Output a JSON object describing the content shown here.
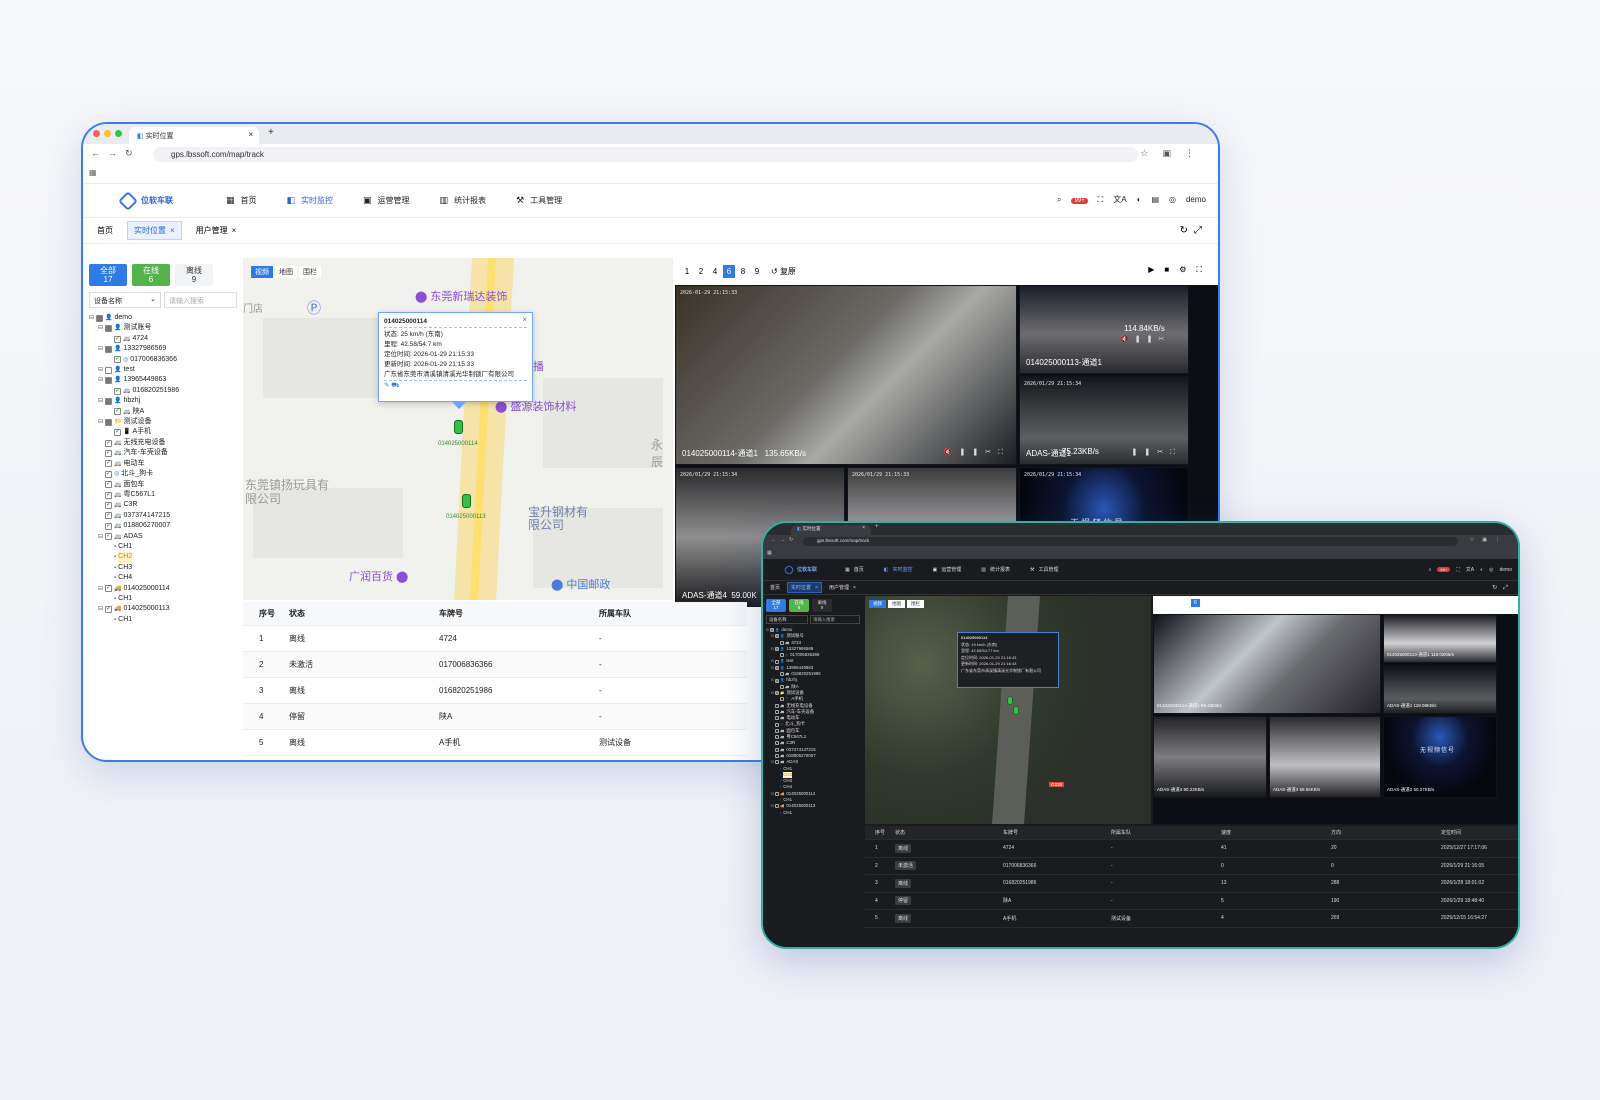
{
  "browser": {
    "tab_title": "实时位置",
    "url": "gps.lbssoft.com/map/track"
  },
  "app": {
    "logo": "位软车联",
    "user": "demo",
    "badge": "99+"
  },
  "menu": [
    {
      "label": "首页",
      "icon": "▦"
    },
    {
      "label": "实时监控",
      "icon": "◧"
    },
    {
      "label": "运营管理",
      "icon": "▣"
    },
    {
      "label": "统计报表",
      "icon": "▥"
    },
    {
      "label": "工具管理",
      "icon": "⚒"
    }
  ],
  "tags": [
    {
      "label": "首页"
    },
    {
      "label": "实时位置"
    },
    {
      "label": "用户管理"
    }
  ],
  "filter": {
    "all_label": "全部",
    "all_count": "17",
    "online_label": "在线",
    "online_count": "6",
    "offline_label": "离线",
    "offline_count": "9",
    "select": "设备名称",
    "search_placeholder": "请输入搜索"
  },
  "tree": [
    {
      "lvl": 0,
      "exp": "⊟",
      "cb": "part",
      "icon": "👤",
      "text": "demo"
    },
    {
      "lvl": 1,
      "exp": "⊟",
      "cb": "part",
      "icon": "👤",
      "text": "测试账号"
    },
    {
      "lvl": 2,
      "exp": "",
      "cb": "chk",
      "icon": "🚐",
      "text": "4724"
    },
    {
      "lvl": 1,
      "exp": "⊟",
      "cb": "part",
      "icon": "👤",
      "text": "13327986569"
    },
    {
      "lvl": 2,
      "exp": "",
      "cb": "chk",
      "icon": "◎",
      "text": "017006836366"
    },
    {
      "lvl": 1,
      "exp": "⊟",
      "cb": "",
      "icon": "👤",
      "text": "test"
    },
    {
      "lvl": 1,
      "exp": "⊟",
      "cb": "part",
      "icon": "👤",
      "text": "13965449863"
    },
    {
      "lvl": 2,
      "exp": "",
      "cb": "chk",
      "icon": "🚐",
      "text": "016820251986"
    },
    {
      "lvl": 1,
      "exp": "⊟",
      "cb": "part",
      "icon": "👤",
      "text": "hbzhj"
    },
    {
      "lvl": 2,
      "exp": "",
      "cb": "chk",
      "icon": "🚐",
      "text": "陕A"
    },
    {
      "lvl": 1,
      "exp": "⊟",
      "cb": "part",
      "icon": "📁",
      "text": "测试设备"
    },
    {
      "lvl": 2,
      "exp": "",
      "cb": "chk",
      "icon": "📱",
      "text": "A手机"
    },
    {
      "lvl": 1,
      "exp": "",
      "cb": "chk",
      "icon": "🚐",
      "text": "无线充电设备"
    },
    {
      "lvl": 1,
      "exp": "",
      "cb": "chk",
      "icon": "🚐",
      "text": "汽车-车壳设备"
    },
    {
      "lvl": 1,
      "exp": "",
      "cb": "chk",
      "icon": "🚐",
      "text": "电动车"
    },
    {
      "lvl": 1,
      "exp": "",
      "cb": "chk",
      "icon": "◎",
      "text": "北斗_狗卡"
    },
    {
      "lvl": 1,
      "exp": "",
      "cb": "chk",
      "icon": "🚐",
      "text": "面包车"
    },
    {
      "lvl": 1,
      "exp": "",
      "cb": "chk",
      "icon": "🚐",
      "text": "粤C567L1"
    },
    {
      "lvl": 1,
      "exp": "",
      "cb": "chk",
      "icon": "🚐",
      "text": "C3R"
    },
    {
      "lvl": 1,
      "exp": "",
      "cb": "chk",
      "icon": "🚐",
      "text": "037374147215"
    },
    {
      "lvl": 1,
      "exp": "",
      "cb": "chk",
      "icon": "🚐",
      "text": "018806270007"
    },
    {
      "lvl": 1,
      "exp": "⊟",
      "cb": "chk",
      "icon": "🚐",
      "text": "ADAS"
    },
    {
      "lvl": 2,
      "exp": "",
      "cb": "",
      "icon": "▪",
      "text": "CH1"
    },
    {
      "lvl": 2,
      "exp": "",
      "cb": "",
      "icon": "▪",
      "text": "CH2",
      "hl": true
    },
    {
      "lvl": 2,
      "exp": "",
      "cb": "",
      "icon": "▪",
      "text": "CH3"
    },
    {
      "lvl": 2,
      "exp": "",
      "cb": "",
      "icon": "▪",
      "text": "CH4"
    },
    {
      "lvl": 1,
      "exp": "⊟",
      "cb": "chk",
      "icon": "🚚",
      "text": "014025000114"
    },
    {
      "lvl": 2,
      "exp": "",
      "cb": "",
      "icon": "▪",
      "text": "CH1"
    },
    {
      "lvl": 1,
      "exp": "⊟",
      "cb": "chk",
      "icon": "🚚",
      "text": "014025000113"
    },
    {
      "lvl": 2,
      "exp": "",
      "cb": "",
      "icon": "▪",
      "text": "CH1"
    }
  ],
  "map": {
    "tab_video": "视频",
    "tab_map": "地图",
    "tab_fence": "围栏",
    "pois": [
      "东莞新瑞达装饰",
      "盛源装饰材料",
      "东莞镇扬玩具有限公司",
      "宝升钢材有限公司",
      "广润百货",
      "中国邮政",
      "门店",
      "播",
      "永辰"
    ],
    "car1": "014025000114",
    "car2": "014025000113"
  },
  "popup": {
    "title": "014025000114",
    "status_label": "状态:",
    "status": "25 km/h (东南)",
    "mileage_label": "里程:",
    "mileage": "42.58/54.7 km",
    "loc_time_label": "定位时间:",
    "loc_time": "2026-01-29 21:15:33",
    "upd_time_label": "更新时间:",
    "upd_time": "2026-01-29 21:15:33",
    "address": "广东省东莞市清溪镇清溪光华制锁厂有限公司"
  },
  "video": {
    "pages": [
      "1",
      "2",
      "4",
      "6",
      "8",
      "9"
    ],
    "active_page": "6",
    "restore": "复原",
    "cells": [
      {
        "label": "014025000114-通道1",
        "rate": "135.65KB/s"
      },
      {
        "label": "014025000113-通道1",
        "rate": "114.84KB/s"
      },
      {
        "label": "ADAS-通道1",
        "rate": "75.23KB/s"
      },
      {
        "label": "ADAS-通道4",
        "rate": "59.00K"
      },
      {
        "label": "",
        "rate": ""
      },
      {
        "label": "无视频信号",
        "rate": ""
      }
    ]
  },
  "table": {
    "headers": [
      "序号",
      "状态",
      "车牌号",
      "所属车队"
    ],
    "rows": [
      [
        "1",
        "离线",
        "4724",
        "-"
      ],
      [
        "2",
        "未激活",
        "017006836366",
        "-"
      ],
      [
        "3",
        "离线",
        "016820251986",
        "-"
      ],
      [
        "4",
        "停留",
        "陕A",
        "-"
      ],
      [
        "5",
        "离线",
        "A手机",
        "测试设备"
      ]
    ]
  },
  "dark": {
    "popup": {
      "title": "014025000114",
      "status": "19 km/h (东南)",
      "mileage": "42.65/54.77 km",
      "loc_time": "2026-01-29 21:16:43",
      "upd_time": "2026-01-29 21:16:43",
      "address": "广东省东莞市清溪镇清溪光华制锁厂有限公司"
    },
    "active_page": "6",
    "cells": [
      {
        "label": "014025000114-通道1",
        "rate": "99.43KB/s"
      },
      {
        "label": "014025000113-通道1",
        "rate": "118.02KB/s"
      },
      {
        "label": "ADAS-通道1",
        "rate": "118.08KB/s"
      },
      {
        "label": "ADAS-通道4",
        "rate": "90.22KB/s"
      },
      {
        "label": "ADAS-通道3",
        "rate": "58.56KB/s"
      },
      {
        "label": "ADAS-通道2",
        "rate": "50.27KB/s"
      }
    ],
    "no_signal": "无视频信号",
    "road_tag": "G228",
    "headers": [
      "序号",
      "状态",
      "车牌号",
      "所属车队",
      "速度",
      "方向",
      "定位时间"
    ],
    "rows": [
      [
        "1",
        "离线",
        "4724",
        "-",
        "41",
        "20",
        "2025/12/27 17:17:06"
      ],
      [
        "2",
        "未激活",
        "017006836366",
        "-",
        "0",
        "0",
        "2026/1/29 21:16:05"
      ],
      [
        "3",
        "离线",
        "016820251986",
        "-",
        "13",
        "288",
        "2026/1/28 18:01:02"
      ],
      [
        "4",
        "停留",
        "陕A",
        "-",
        "5",
        "190",
        "2026/1/29 18:48:40"
      ],
      [
        "5",
        "离线",
        "A手机",
        "测试设备",
        "4",
        "269",
        "2025/12/15 16:54:27"
      ]
    ]
  },
  "colors": {
    "accent": "#2e7be6",
    "online": "#53b44b",
    "frame1": "#3d7be8",
    "frame2": "#2fb3a0"
  }
}
